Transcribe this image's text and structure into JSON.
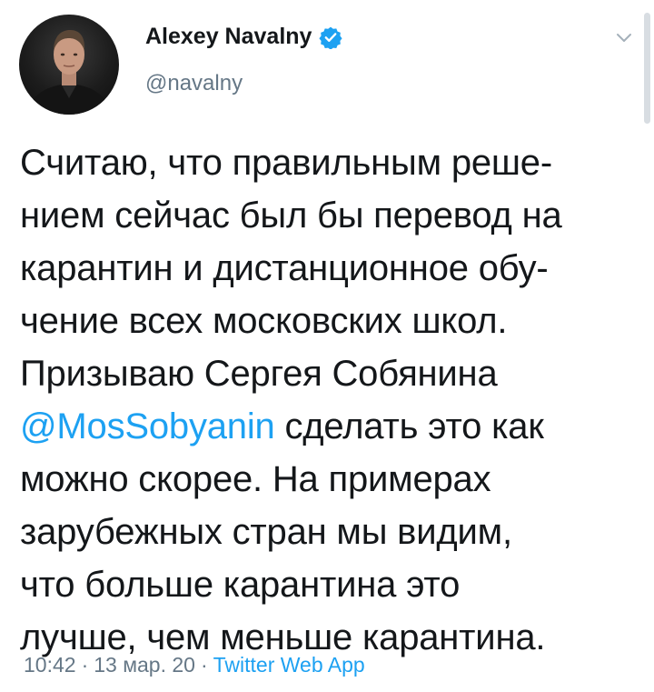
{
  "author": {
    "name": "Alexey Navalny",
    "handle": "@navalny",
    "verified": true
  },
  "tweet": {
    "lines": [
      "Считаю, что правильным реше-",
      "нием сейчас был бы перевод на",
      "карантин и дистанционное обу-",
      "чение всех московских школ.",
      "Призываю Сергея Собянина"
    ],
    "mention": "@MosSobyanin",
    "mention_tail": " сделать это как",
    "lines_after": [
      "можно скорее. На примерах",
      "зарубежных стран мы видим,",
      "что больше карантина это",
      "лучше, чем меньше карантина."
    ]
  },
  "meta": {
    "time": "10:42",
    "separator": "·",
    "date": "13 мар. 20",
    "source": "Twitter Web App"
  },
  "colors": {
    "accent": "#1da1f2",
    "secondary_text": "#657786",
    "primary_text": "#14171a"
  },
  "icons": {
    "verified": "verified-badge-icon",
    "caret": "chevron-down-icon"
  }
}
